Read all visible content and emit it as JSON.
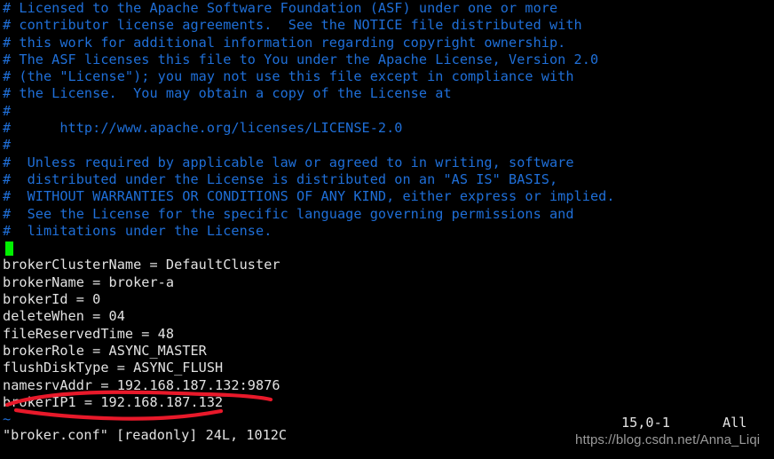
{
  "terminal": {
    "background_color": "#000000",
    "comment_color": "#1f6fd8",
    "text_color": "#e2e2e2",
    "cursor_color": "#00f000",
    "annotation_color": "#e8192a",
    "watermark_color": "#9a9a9a"
  },
  "editor": {
    "program": "vim",
    "filename": "broker.conf"
  },
  "lines": [
    {
      "text": "# Licensed to the Apache Software Foundation (ASF) under one or more",
      "kind": "comment"
    },
    {
      "text": "# contributor license agreements.  See the NOTICE file distributed with",
      "kind": "comment"
    },
    {
      "text": "# this work for additional information regarding copyright ownership.",
      "kind": "comment"
    },
    {
      "text": "# The ASF licenses this file to You under the Apache License, Version 2.0",
      "kind": "comment"
    },
    {
      "text": "# (the \"License\"); you may not use this file except in compliance with",
      "kind": "comment"
    },
    {
      "text": "# the License.  You may obtain a copy of the License at",
      "kind": "comment"
    },
    {
      "text": "#",
      "kind": "comment"
    },
    {
      "text": "#      http://www.apache.org/licenses/LICENSE-2.0",
      "kind": "comment"
    },
    {
      "text": "#",
      "kind": "comment"
    },
    {
      "text": "#  Unless required by applicable law or agreed to in writing, software",
      "kind": "comment"
    },
    {
      "text": "#  distributed under the License is distributed on an \"AS IS\" BASIS,",
      "kind": "comment"
    },
    {
      "text": "#  WITHOUT WARRANTIES OR CONDITIONS OF ANY KIND, either express or implied.",
      "kind": "comment"
    },
    {
      "text": "#  See the License for the specific language governing permissions and",
      "kind": "comment"
    },
    {
      "text": "#  limitations under the License.",
      "kind": "comment"
    },
    {
      "text": "",
      "kind": "cursor"
    },
    {
      "text": "brokerClusterName = DefaultCluster",
      "kind": "config"
    },
    {
      "text": "brokerName = broker-a",
      "kind": "config"
    },
    {
      "text": "brokerId = 0",
      "kind": "config"
    },
    {
      "text": "deleteWhen = 04",
      "kind": "config"
    },
    {
      "text": "fileReservedTime = 48",
      "kind": "config"
    },
    {
      "text": "brokerRole = ASYNC_MASTER",
      "kind": "config"
    },
    {
      "text": "flushDiskType = ASYNC_FLUSH",
      "kind": "config"
    },
    {
      "text": "namesrvAddr = 192.168.187.132:9876",
      "kind": "config"
    },
    {
      "text": "brokerIP1 = 192.168.187.132",
      "kind": "config"
    },
    {
      "text": "~",
      "kind": "tilde"
    }
  ],
  "status": {
    "message": "\"broker.conf\" [readonly] 24L, 1012C",
    "ruler_position": "15,0-1",
    "ruler_scroll": "All"
  },
  "annotations": {
    "stroke_color": "#e8192a",
    "strokes": [
      {
        "name": "strikethrough-brokerip1",
        "description": "red curved line drawn through the brokerIP1 line"
      },
      {
        "name": "underline-brokerip1",
        "description": "red curved underline beneath the brokerIP1 line"
      }
    ]
  },
  "watermark": {
    "text": "https://blog.csdn.net/Anna_Liqi"
  }
}
